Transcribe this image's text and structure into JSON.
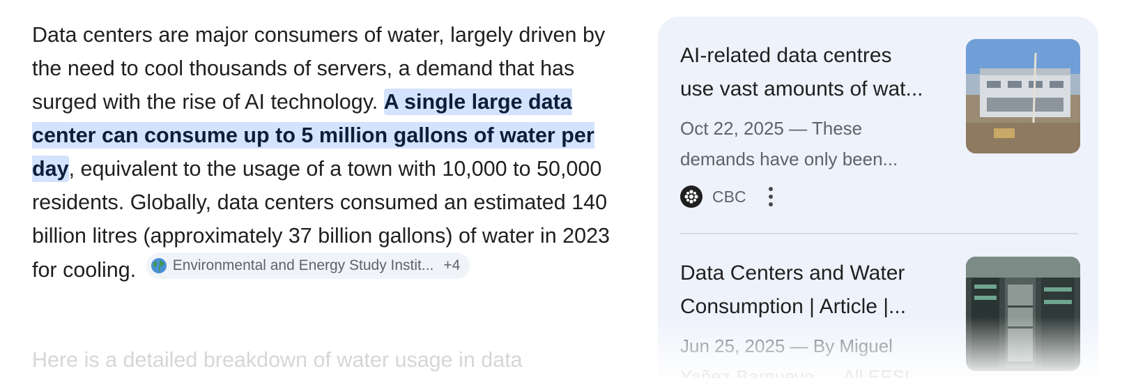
{
  "answer": {
    "text_before": "Data centers are major consumers of water, largely driven by the need to cool thousands of servers, a demand that has surged with the rise of AI technology. ",
    "highlight_pre": "A single large data center can consume up to ",
    "highlight_bold": "5 million gallons of water per day",
    "text_after": ", equivalent to the usage of a town with 10,000 to 50,000 residents. Globally, data centers consumed an estimated 140 billion litres (approximately 37 billion gallons) of water in 2023 for cooling.",
    "source_chip": {
      "label": "Environmental and Energy Study Instit...",
      "more": "+4",
      "icon": "globe-icon"
    },
    "next_paragraph": "Here is a detailed breakdown of water usage in data"
  },
  "sources": [
    {
      "title_line1": "AI-related data centres",
      "title_line2": "use vast amounts of wat...",
      "snippet_line1": "Oct 22, 2025 — These",
      "snippet_line2": "demands have only been...",
      "publisher": "CBC",
      "publisher_icon": "cbc-gem-icon",
      "thumbnail": "construction-site-image"
    },
    {
      "title_line1": "Data Centers and Water",
      "title_line2": "Consumption | Article |...",
      "snippet_line1": "Jun 25, 2025 — By Miguel",
      "snippet_line2": "Yañez-Barnuevo, ... All EESI...",
      "thumbnail": "server-room-image"
    }
  ],
  "colors": {
    "highlight": "#d3e3fd",
    "card_bg": "#eef2fb",
    "muted_text": "#5f6368"
  }
}
